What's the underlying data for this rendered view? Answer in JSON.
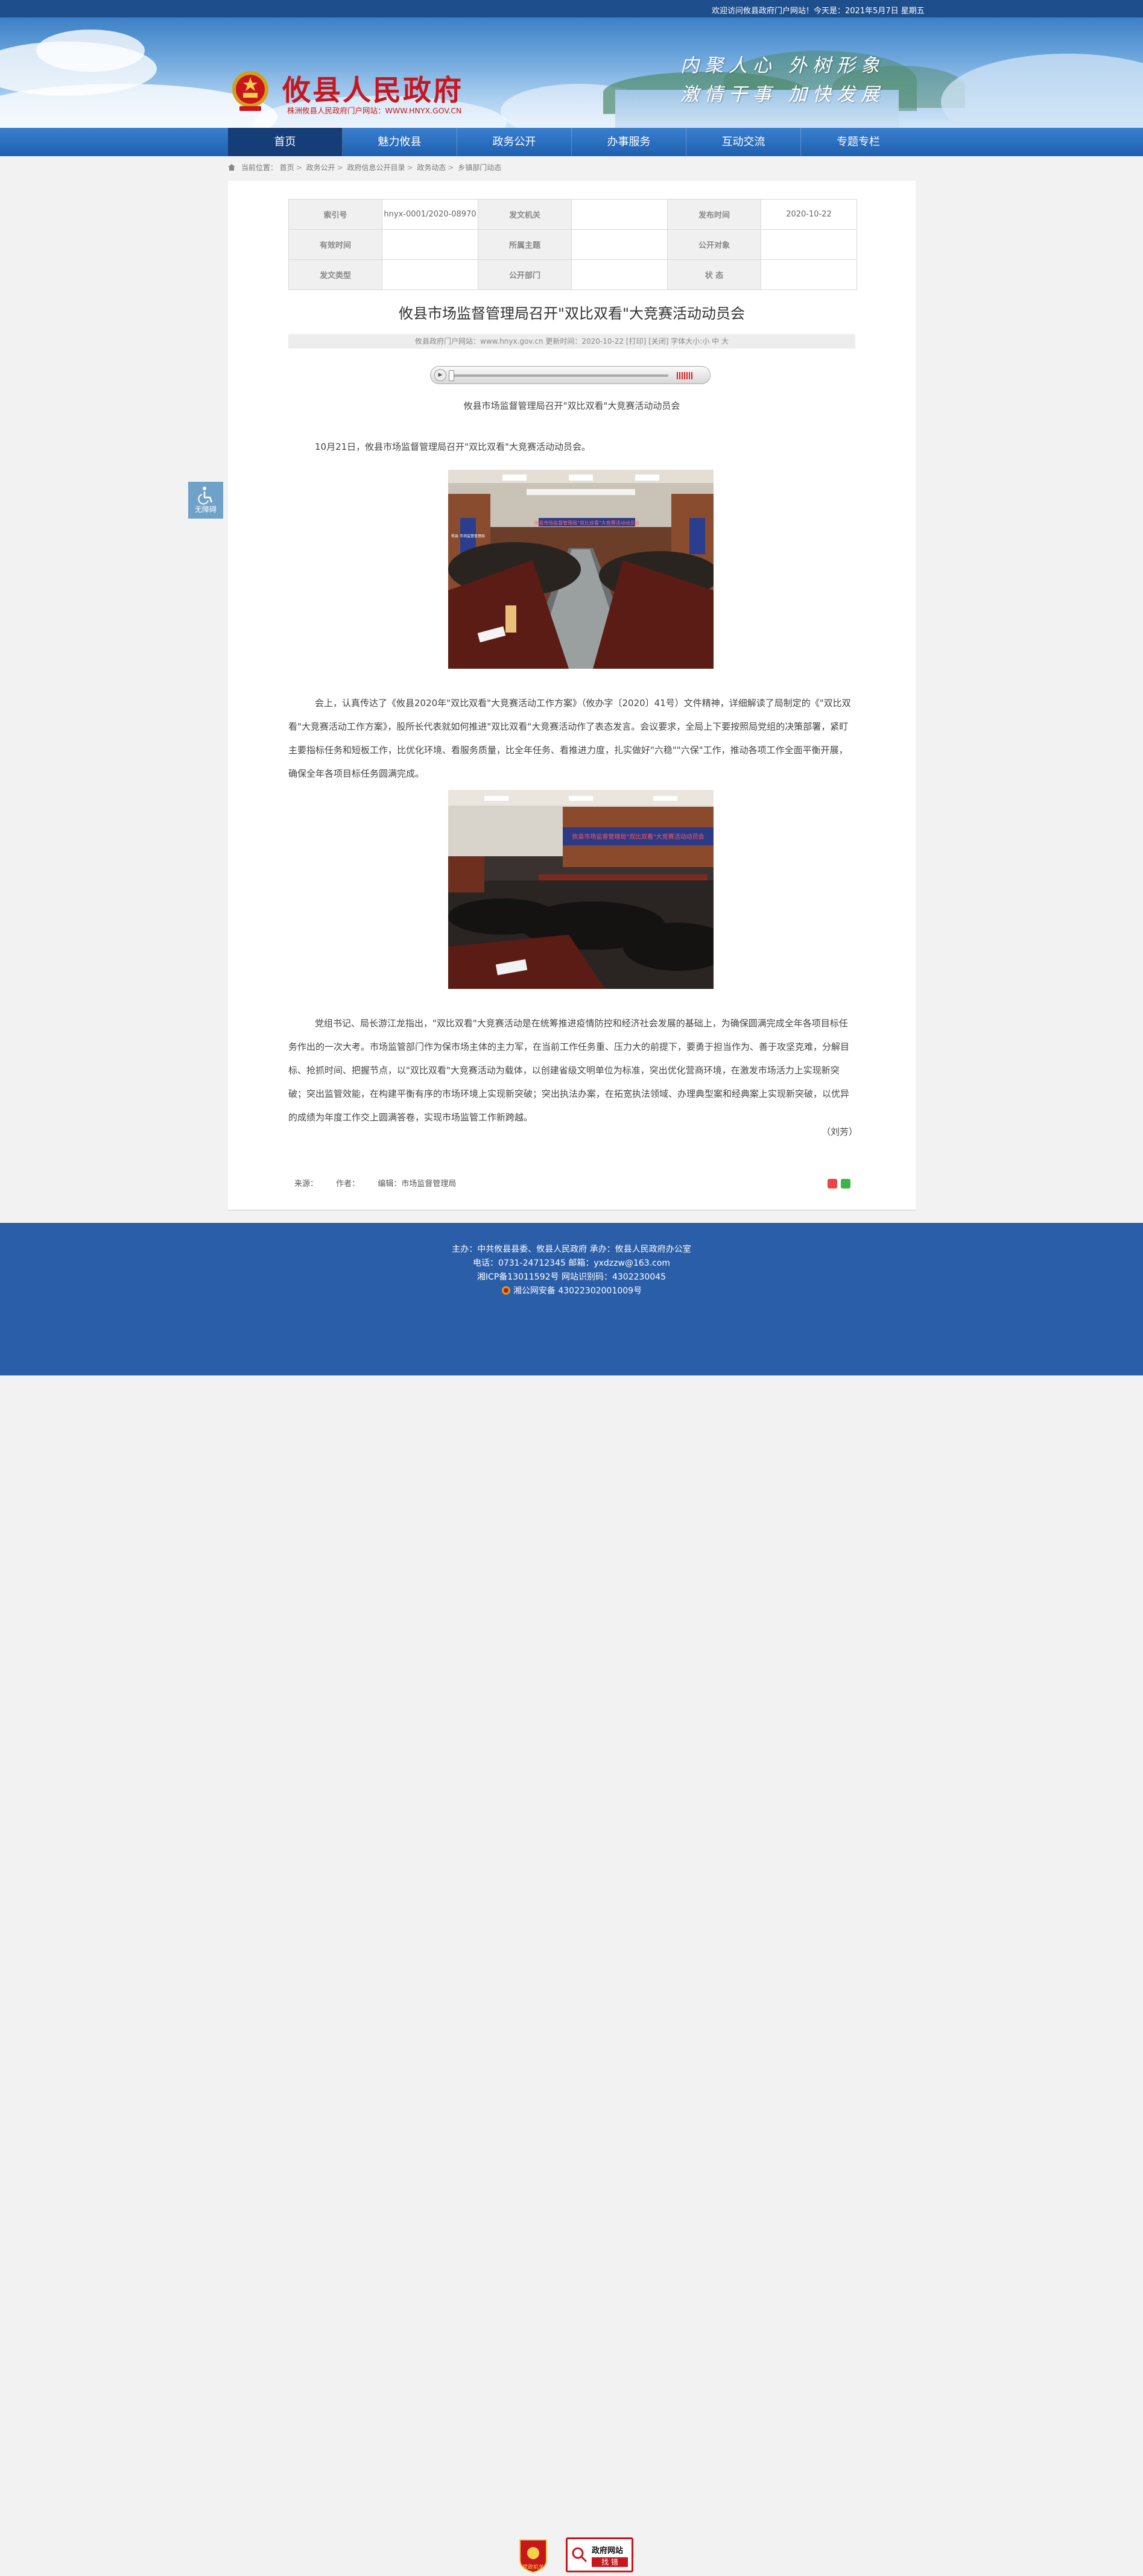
{
  "topbar": {
    "welcome": "欢迎访问攸县政府门户网站！今天是：2021年5月7日 星期五"
  },
  "header": {
    "site_name": "攸县人民政府",
    "site_url": "株洲攸县人民政府门户网站：WWW.HNYX.GOV.CN",
    "slogan_line1": "内聚人心 外树形象",
    "slogan_line2": "激情干事 加快发展"
  },
  "nav": {
    "items": [
      {
        "label": "首页"
      },
      {
        "label": "魅力攸县"
      },
      {
        "label": "政务公开"
      },
      {
        "label": "办事服务"
      },
      {
        "label": "互动交流"
      },
      {
        "label": "专题专栏"
      }
    ]
  },
  "breadcrumb": {
    "prefix": "当前位置：",
    "items": [
      "首页",
      "政务公开",
      "政府信息公开目录",
      "政务动态",
      "乡镇部门动态"
    ]
  },
  "meta_table": {
    "index_label": "索引号",
    "index_value": "hnyx-0001/2020-08970",
    "issuer_label": "发文机关",
    "issuer_value": "",
    "date_label": "发布时间",
    "date_value": "2020-10-22",
    "validity_label": "有效时间",
    "validity_value": "",
    "topic_label": "所属主题",
    "topic_value": "",
    "audience_label": "公开对象",
    "audience_value": "",
    "doctype_label": "发文类型",
    "doctype_value": "",
    "dept_label": "公开部门",
    "dept_value": "",
    "status_label": "状 态",
    "status_value": ""
  },
  "article": {
    "title": "攸县市场监督管理局召开\"双比双看\"大竞赛活动动员会",
    "info_line": "攸县政府门户网站：www.hnyx.gov.cn   更新时间：2020-10-22  [打印] [关闭]  字体大小:小 中 大",
    "subtitle": "攸县市场监督管理局召开\"双比双看\"大竞赛活动动员会",
    "p1": "10月21日，攸县市场监督管理局召开\"双比双看\"大竞赛活动动员会。",
    "p2": "会上，认真传达了《攸县2020年\"双比双看\"大竞赛活动工作方案》（攸办字〔2020〕41号）文件精神，详细解读了局制定的《\"双比双看\"大竞赛活动工作方案》，股所长代表就如何推进\"双比双看\"大竞赛活动作了表态发言。会议要求，全局上下要按照局党组的决策部署，紧盯主要指标任务和短板工作，比优化环境、看服务质量，比全年任务、看推进力度，扎实做好\"六稳\"\"六保\"工作，推动各项工作全面平衡开展，确保全年各项目标任务圆满完成。",
    "p3": "党组书记、局长游江龙指出，\"双比双看\"大竞赛活动是在统筹推进疫情防控和经济社会发展的基础上，为确保圆满完成全年各项目标任务作出的一次大考。市场监管部门作为保市场主体的主力军，在当前工作任务重、压力大的前提下，要勇于担当作为、善于攻坚克难，分解目标、抢抓时间、把握节点，以\"双比双看\"大竞赛活动为载体，以创建省级文明单位为标准，突出优化营商环境，在激发市场活力上实现新突破；突出监管效能，在构建平衡有序的市场环境上实现新突破；突出执法办案，在拓宽执法领域、办理典型案和经典案上实现新突破，以优异的成绩为年度工作交上圆满答卷，实现市场监管工作新跨越。",
    "signature": "（刘芳）",
    "banner_text_photo1": "攸县市场监督管理局\"双比双看\"大竞赛活动动员会",
    "banner_text_photo2": "攸县市场监督管理局\"双比双看\"大竞赛活动动员会",
    "side_board_text": "攸县 市场监督管理局"
  },
  "article_footer": {
    "source": "来源：",
    "author": "作者：",
    "editor": "编辑：市场监督管理局"
  },
  "accessibility": {
    "label": "无障碍"
  },
  "footer": {
    "line1": "主办：中共攸县县委、攸县人民政府 承办：攸县人民政府办公室",
    "line2": "电话：0731-24712345 邮箱：yxdzzw@163.com",
    "line3": "湘ICP备13011592号   网站识别码：4302230045",
    "line4": "湘公网安备 43022302001009号",
    "badge1": "党政机关",
    "badge2_line1": "政府网站",
    "badge2_line2": "找 错"
  },
  "colors": {
    "nav_bg": "#1f5fae",
    "nav_active": "#153e78",
    "title_red": "#c8161d",
    "footer_bg": "#2a5ea8"
  }
}
